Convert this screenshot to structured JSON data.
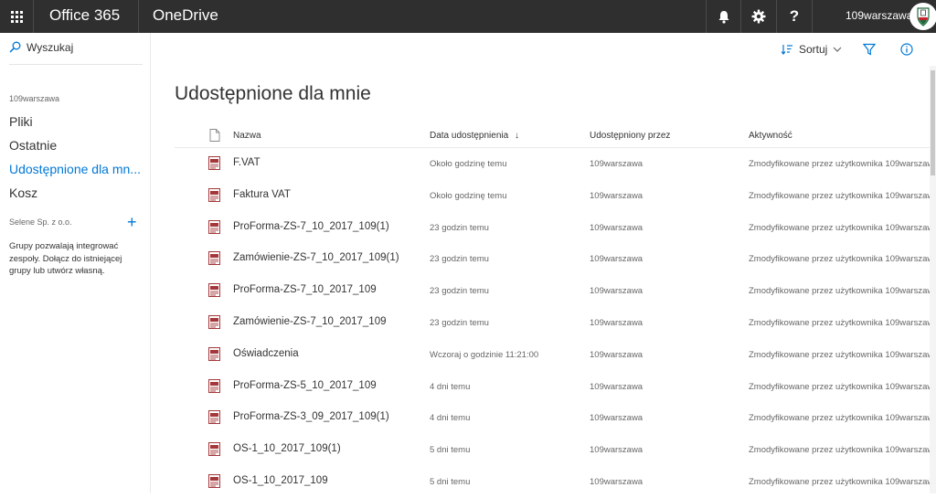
{
  "topbar": {
    "brand": "Office 365",
    "app": "OneDrive",
    "username": "109warszawa",
    "icons": [
      "app-launcher-icon",
      "bell-icon",
      "gear-icon",
      "help-icon"
    ]
  },
  "leftnav": {
    "search_label": "Wyszukaj",
    "group_label": "109warszawa",
    "items": [
      {
        "label": "Pliki"
      },
      {
        "label": "Ostatnie"
      },
      {
        "label": "Udostępnione dla mn..."
      },
      {
        "label": "Kosz"
      }
    ],
    "org_label": "Selene Sp. z o.o.",
    "groups_text": "Grupy pozwalają integrować zespoły. Dołącz do istniejącej grupy lub utwórz własną."
  },
  "commandbar": {
    "sort_label": "Sortuj"
  },
  "main": {
    "title": "Udostępnione dla mnie",
    "columns": {
      "name": "Nazwa",
      "date": "Data udostępnienia",
      "shared_by": "Udostępniony przez",
      "activity": "Aktywność"
    },
    "rows": [
      {
        "name": "F.VAT",
        "date": "Około godzinę temu",
        "by": "109warszawa",
        "activity": "Zmodyfikowane przez użytkownika 109warszaw"
      },
      {
        "name": "Faktura VAT",
        "date": "Około godzinę temu",
        "by": "109warszawa",
        "activity": "Zmodyfikowane przez użytkownika 109warszaw"
      },
      {
        "name": "ProForma-ZS-7_10_2017_109(1)",
        "date": "23 godzin temu",
        "by": "109warszawa",
        "activity": "Zmodyfikowane przez użytkownika 109warszaw"
      },
      {
        "name": "Zamówienie-ZS-7_10_2017_109(1)",
        "date": "23 godzin temu",
        "by": "109warszawa",
        "activity": "Zmodyfikowane przez użytkownika 109warszaw"
      },
      {
        "name": "ProForma-ZS-7_10_2017_109",
        "date": "23 godzin temu",
        "by": "109warszawa",
        "activity": "Zmodyfikowane przez użytkownika 109warszaw"
      },
      {
        "name": "Zamówienie-ZS-7_10_2017_109",
        "date": "23 godzin temu",
        "by": "109warszawa",
        "activity": "Zmodyfikowane przez użytkownika 109warszaw"
      },
      {
        "name": "Oświadczenia",
        "date": "Wczoraj o godzinie 11:21:00",
        "by": "109warszawa",
        "activity": "Zmodyfikowane przez użytkownika 109warszaw"
      },
      {
        "name": "ProForma-ZS-5_10_2017_109",
        "date": "4 dni temu",
        "by": "109warszawa",
        "activity": "Zmodyfikowane przez użytkownika 109warszaw"
      },
      {
        "name": "ProForma-ZS-3_09_2017_109(1)",
        "date": "4 dni temu",
        "by": "109warszawa",
        "activity": "Zmodyfikowane przez użytkownika 109warszaw"
      },
      {
        "name": "OS-1_10_2017_109(1)",
        "date": "5 dni temu",
        "by": "109warszawa",
        "activity": "Zmodyfikowane przez użytkownika 109warszaw"
      },
      {
        "name": "OS-1_10_2017_109",
        "date": "5 dni temu",
        "by": "109warszawa",
        "activity": "Zmodyfikowane przez użytkownika 109warszaw"
      }
    ]
  },
  "colors": {
    "topbar_bg": "#2f2f2f",
    "accent": "#0078d7",
    "pdf_red": "#a4373a"
  }
}
